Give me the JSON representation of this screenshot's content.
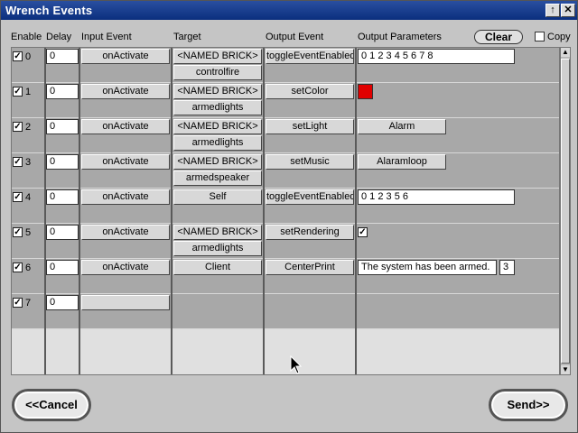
{
  "window": {
    "title": "Wrench Events",
    "up_icon": "↑",
    "close_icon": "✕"
  },
  "headers": {
    "enable": "Enable",
    "delay": "Delay",
    "input_event": "Input Event",
    "target": "Target",
    "output_event": "Output Event",
    "output_parameters": "Output Parameters",
    "clear": "Clear",
    "copy": "Copy"
  },
  "rows": [
    {
      "index": "0",
      "checked": "✓",
      "delay": "0",
      "input": "onActivate",
      "target": "<NAMED BRICK>",
      "target_name": "controlfire",
      "output": "toggleEventEnabled",
      "param": "0 1 2 3 4 5 6 7 8"
    },
    {
      "index": "1",
      "checked": "✓",
      "delay": "0",
      "input": "onActivate",
      "target": "<NAMED BRICK>",
      "target_name": "armedlights",
      "output": "setColor",
      "color": "#e00000"
    },
    {
      "index": "2",
      "checked": "✓",
      "delay": "0",
      "input": "onActivate",
      "target": "<NAMED BRICK>",
      "target_name": "armedlights",
      "output": "setLight",
      "param": "Alarm"
    },
    {
      "index": "3",
      "checked": "✓",
      "delay": "0",
      "input": "onActivate",
      "target": "<NAMED BRICK>",
      "target_name": "armedspeaker",
      "output": "setMusic",
      "param": "Alaramloop"
    },
    {
      "index": "4",
      "checked": "✓",
      "delay": "0",
      "input": "onActivate",
      "target": "Self",
      "output": "toggleEventEnabled",
      "param": "0 1 2 3 5 6"
    },
    {
      "index": "5",
      "checked": "✓",
      "delay": "0",
      "input": "onActivate",
      "target": "<NAMED BRICK>",
      "target_name": "armedlights",
      "output": "setRendering",
      "param_check": "✓"
    },
    {
      "index": "6",
      "checked": "✓",
      "delay": "0",
      "input": "onActivate",
      "target": "Client",
      "output": "CenterPrint",
      "param": "The system has been armed.",
      "param2": "3"
    },
    {
      "index": "7",
      "checked": "✓",
      "delay": "0",
      "input": ""
    }
  ],
  "footer": {
    "cancel": "<<Cancel",
    "send": "Send>>"
  }
}
